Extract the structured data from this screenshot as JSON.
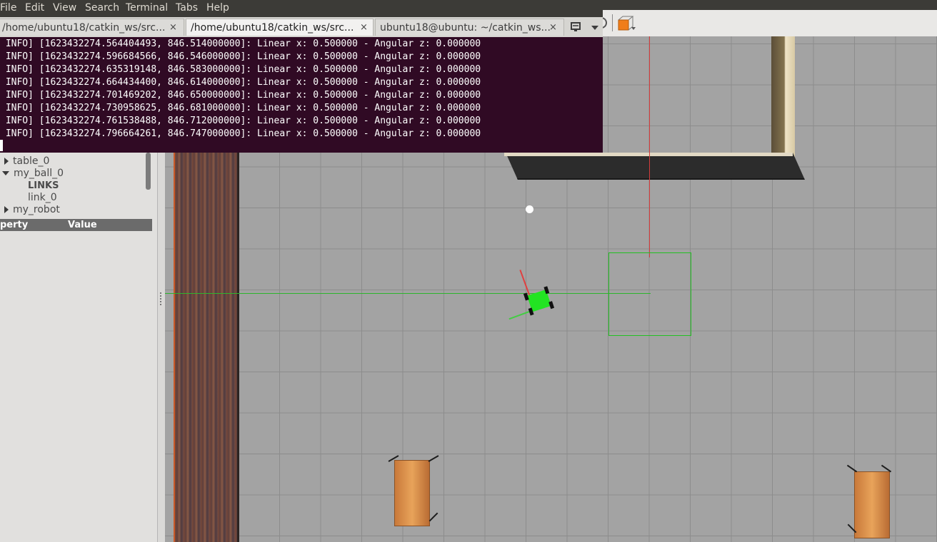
{
  "terminal": {
    "menu": [
      "File",
      "Edit",
      "View",
      "Search",
      "Terminal",
      "Tabs",
      "Help"
    ],
    "tabs": [
      {
        "label": "/home/ubuntu18/catkin_ws/src...",
        "close": "×"
      },
      {
        "label": "/home/ubuntu18/catkin_ws/src...",
        "close": "×"
      },
      {
        "label": "ubuntu18@ubuntu: ~/catkin_ws...",
        "close": "×"
      }
    ],
    "new_tab_icon": "new-tab-icon",
    "lines": [
      " INFO] [1623432274.564404493, 846.514000000]: Linear x: 0.500000 - Angular z: 0.000000",
      " INFO] [1623432274.596684566, 846.546000000]: Linear x: 0.500000 - Angular z: 0.000000",
      " INFO] [1623432274.635319148, 846.583000000]: Linear x: 0.500000 - Angular z: 0.000000",
      " INFO] [1623432274.664434400, 846.614000000]: Linear x: 0.500000 - Angular z: 0.000000",
      " INFO] [1623432274.701469202, 846.650000000]: Linear x: 0.500000 - Angular z: 0.000000",
      " INFO] [1623432274.730958625, 846.681000000]: Linear x: 0.500000 - Angular z: 0.000000",
      " INFO] [1623432274.761538488, 846.712000000]: Linear x: 0.500000 - Angular z: 0.000000",
      " INFO] [1623432274.796664261, 846.747000000]: Linear x: 0.500000 - Angular z: 0.000000"
    ],
    "colors": {
      "background": "#300a24",
      "text": "#ffffff",
      "menubar": "#3c3b37"
    }
  },
  "gazebo": {
    "tree": [
      {
        "label": "table_0",
        "expanded": false
      },
      {
        "label": "my_ball_0",
        "expanded": true
      },
      {
        "label": "LINKS",
        "bold": true
      },
      {
        "label": "link_0"
      },
      {
        "label": "my_robot",
        "expanded": false
      }
    ],
    "properties": {
      "col_property": "perty",
      "col_value": "Value"
    },
    "toolbar_icons": [
      "box-shape-icon"
    ],
    "colors": {
      "ground": "#a3a3a3",
      "robot": "#22e422",
      "x_axis": "#d23b3b",
      "y_axis": "#2db52d"
    }
  }
}
